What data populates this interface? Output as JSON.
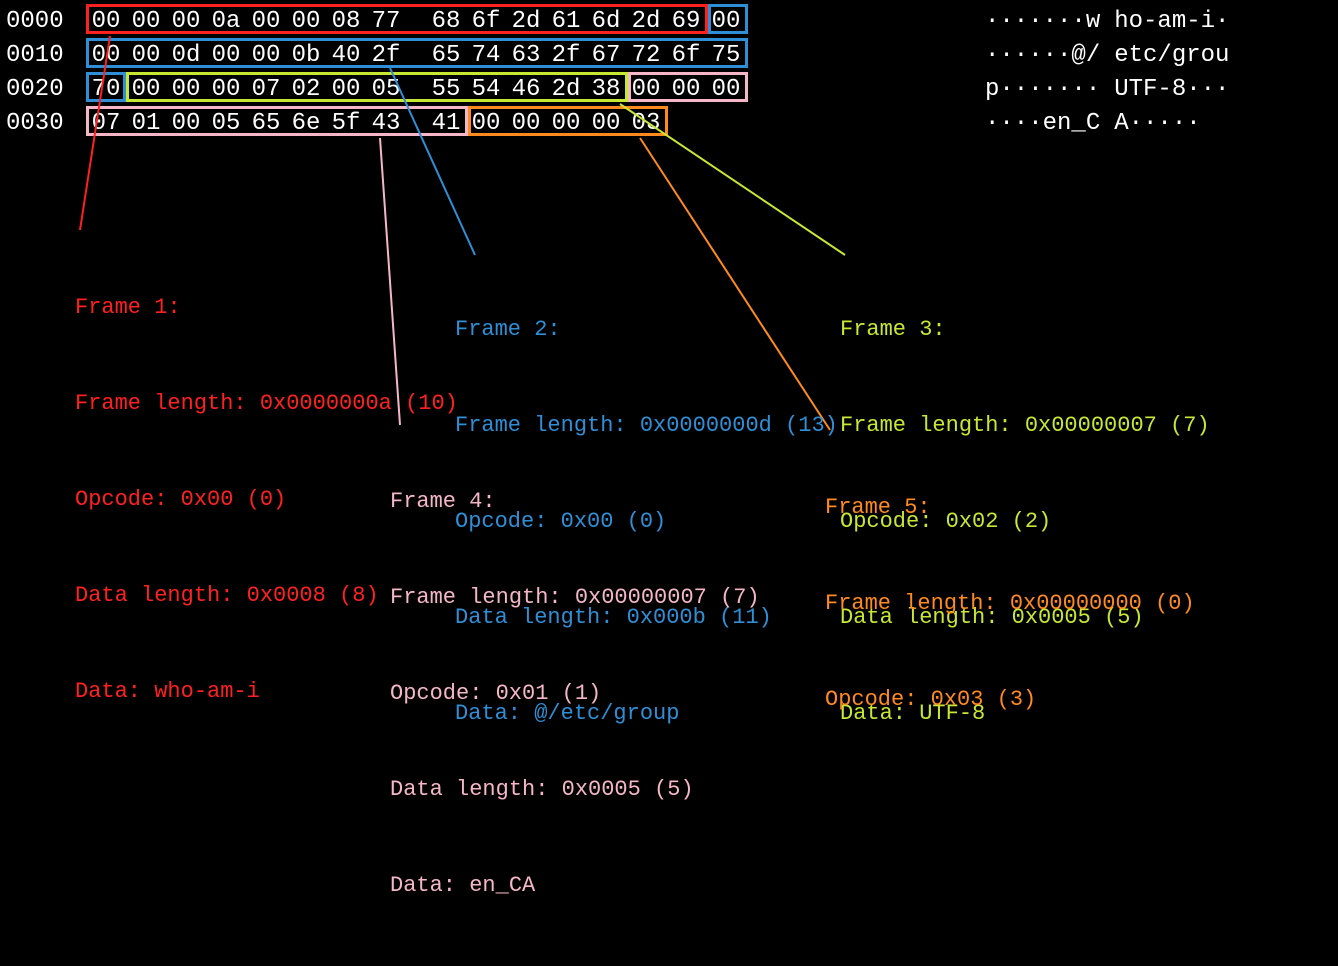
{
  "hexdump": {
    "rows": [
      {
        "offset": "0000",
        "bytes": [
          "00",
          "00",
          "00",
          "0a",
          "00",
          "00",
          "08",
          "77",
          "68",
          "6f",
          "2d",
          "61",
          "6d",
          "2d",
          "69",
          "00"
        ],
        "ascii_left": "·······w",
        "ascii_right": "ho-am-i·"
      },
      {
        "offset": "0010",
        "bytes": [
          "00",
          "00",
          "0d",
          "00",
          "00",
          "0b",
          "40",
          "2f",
          "65",
          "74",
          "63",
          "2f",
          "67",
          "72",
          "6f",
          "75"
        ],
        "ascii_left": "······@/",
        "ascii_right": "etc/grou"
      },
      {
        "offset": "0020",
        "bytes": [
          "70",
          "00",
          "00",
          "00",
          "07",
          "02",
          "00",
          "05",
          "55",
          "54",
          "46",
          "2d",
          "38",
          "00",
          "00",
          "00"
        ],
        "ascii_left": "p·······",
        "ascii_right": "UTF-8···"
      },
      {
        "offset": "0030",
        "bytes": [
          "07",
          "01",
          "00",
          "05",
          "65",
          "6e",
          "5f",
          "43",
          "41",
          "00",
          "00",
          "00",
          "00",
          "03",
          "",
          ""
        ],
        "ascii_left": "····en_C",
        "ascii_right": "A·····"
      }
    ]
  },
  "frames": {
    "f1": {
      "title": "Frame 1:",
      "len": "Frame length: 0x0000000a (10)",
      "op": "Opcode: 0x00 (0)",
      "dlen": "Data length: 0x0008 (8)",
      "data": "Data: who-am-i"
    },
    "f2": {
      "title": "Frame 2:",
      "len": "Frame length: 0x0000000d (13)",
      "op": "Opcode: 0x00 (0)",
      "dlen": "Data length: 0x000b (11)",
      "data": "Data: @/etc/group"
    },
    "f3": {
      "title": "Frame 3:",
      "len": "Frame length: 0x00000007 (7)",
      "op": "Opcode: 0x02 (2)",
      "dlen": "Data length: 0x0005 (5)",
      "data": "Data: UTF-8"
    },
    "f4": {
      "title": "Frame 4:",
      "len": "Frame length: 0x00000007 (7)",
      "op": "Opcode: 0x01 (1)",
      "dlen": "Data length: 0x0005 (5)",
      "data": "Data: en_CA"
    },
    "f5": {
      "title": "Frame 5:",
      "len": "Frame length: 0x00000000 (0)",
      "op": "Opcode: 0x03 (3)"
    }
  },
  "colors": {
    "red": "#ff2020",
    "blue": "#2f8fd6",
    "yellow": "#c7e833",
    "pink": "#f5b6c8",
    "orange": "#ff8a1f"
  }
}
